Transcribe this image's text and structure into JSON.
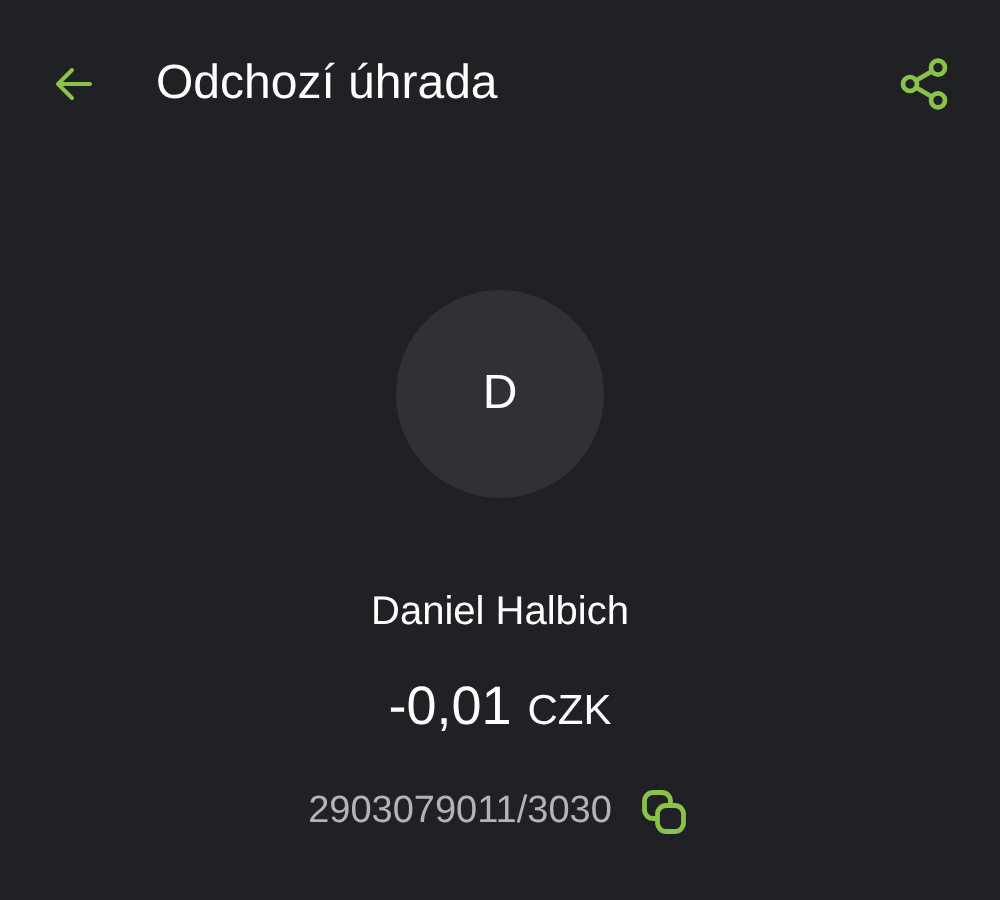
{
  "header": {
    "title": "Odchozí úhrada"
  },
  "counterparty": {
    "initial": "D",
    "name": "Daniel Halbich",
    "amount": "-0,01",
    "currency": "CZK",
    "account": "2903079011/3030"
  }
}
